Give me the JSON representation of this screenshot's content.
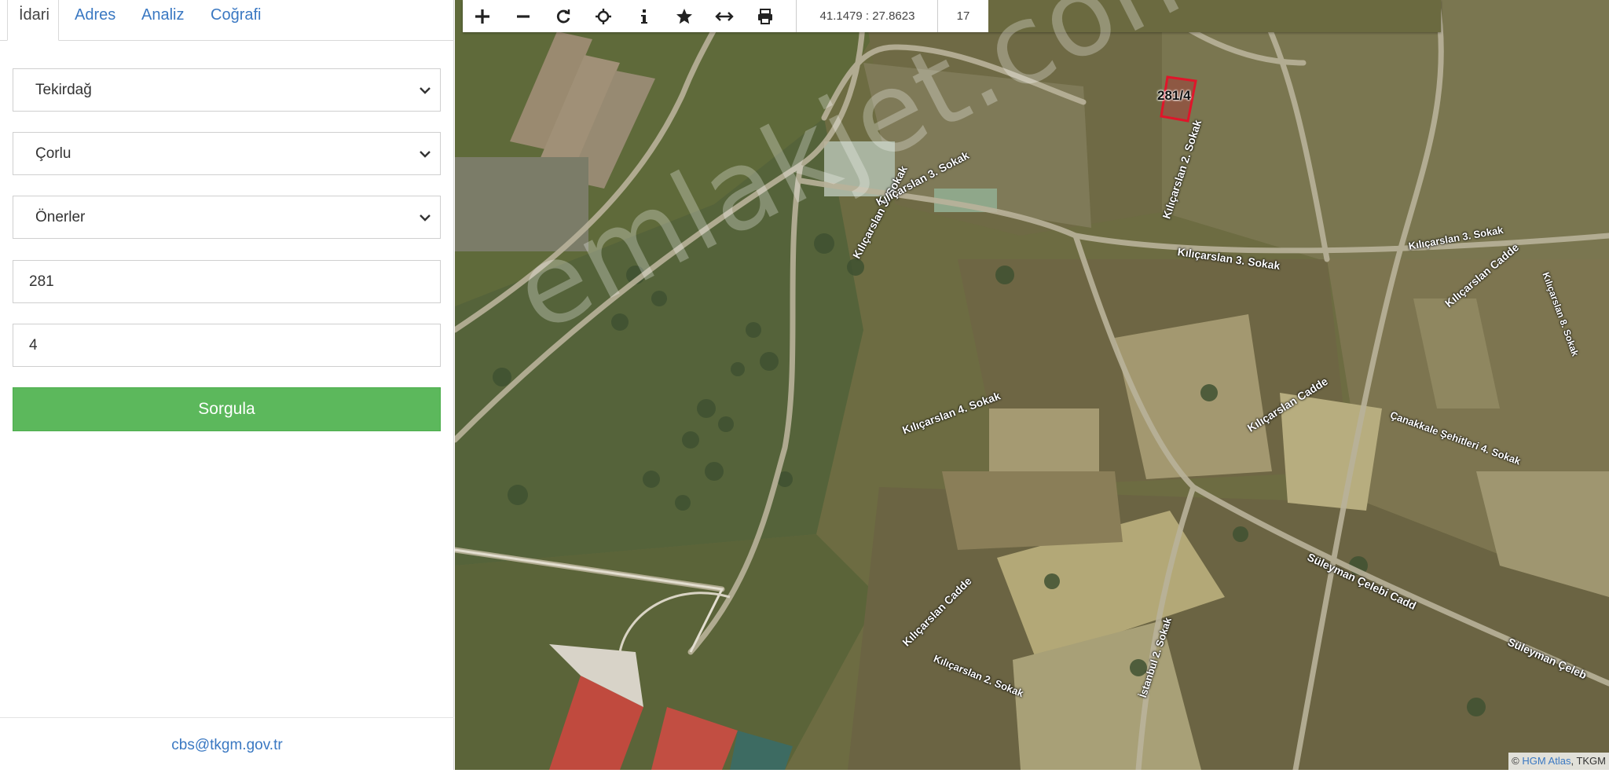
{
  "tabs": [
    {
      "label": "İdari",
      "active": true
    },
    {
      "label": "Adres",
      "active": false
    },
    {
      "label": "Analiz",
      "active": false
    },
    {
      "label": "Coğrafi",
      "active": false
    }
  ],
  "form": {
    "il": "Tekirdağ",
    "ilce": "Çorlu",
    "mahalle": "Önerler",
    "ada": "281",
    "parsel": "4",
    "submit_label": "Sorgula"
  },
  "footer": {
    "email": "cbs@tkgm.gov.tr"
  },
  "toolbar": {
    "tools": [
      "zoom-in-icon",
      "zoom-out-icon",
      "refresh-icon",
      "locate-icon",
      "info-icon",
      "star-icon",
      "measure-icon",
      "print-icon"
    ],
    "coordinates": "41.1479 : 27.8623",
    "zoom_level": "17"
  },
  "map": {
    "parcel_label": "281/4",
    "watermark": "emlakjet.com",
    "road_labels": [
      "Kılıçarslan 3. Sokak",
      "Kılıçarslan 2. Sokak",
      "Kılıçarslan 3. Sokak",
      "Kılıçarslan 3. Sokak",
      "Kılıçarslan Cadde",
      "Kılıçarslan 8. Sokak",
      "Kılıçarslan 3. Sokak",
      "Kılıçarslan 4. Sokak",
      "Kılıçarslan Cadde",
      "Çanakkale Şehitleri 4. Sokak",
      "Süleyman Çelebi Cadd",
      "Süleyman Çeleb",
      "Kılıçarslan Cadde",
      "Kılıçarslan 2. Sokak",
      "İstanbul 2. Sokak"
    ],
    "attribution_prefix": "©",
    "attribution_link": "HGM Atlas",
    "attribution_suffix": ", TKGM"
  },
  "colors": {
    "primary_button": "#5cb85c",
    "link": "#3a78c2",
    "parcel_outline": "#e0152a"
  }
}
